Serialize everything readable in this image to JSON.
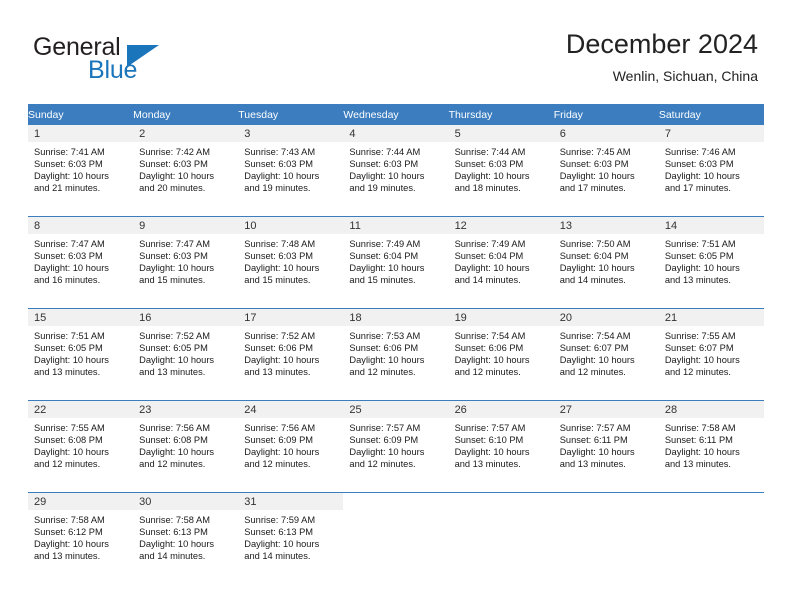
{
  "logo": {
    "line1": "General",
    "line2": "Blue",
    "triangle_icon": "blue-triangle-icon",
    "brand_color": "#1b75bb"
  },
  "header": {
    "title": "December 2024",
    "subtitle": "Wenlin, Sichuan, China"
  },
  "calendar": {
    "header_background": "#3b7dbf",
    "daynum_background": "#f1f1f1",
    "weekdays": [
      "Sunday",
      "Monday",
      "Tuesday",
      "Wednesday",
      "Thursday",
      "Friday",
      "Saturday"
    ],
    "weeks": [
      [
        {
          "day": "1",
          "sunrise": "Sunrise: 7:41 AM",
          "sunset": "Sunset: 6:03 PM",
          "daylight_line1": "Daylight: 10 hours",
          "daylight_line2": "and 21 minutes."
        },
        {
          "day": "2",
          "sunrise": "Sunrise: 7:42 AM",
          "sunset": "Sunset: 6:03 PM",
          "daylight_line1": "Daylight: 10 hours",
          "daylight_line2": "and 20 minutes."
        },
        {
          "day": "3",
          "sunrise": "Sunrise: 7:43 AM",
          "sunset": "Sunset: 6:03 PM",
          "daylight_line1": "Daylight: 10 hours",
          "daylight_line2": "and 19 minutes."
        },
        {
          "day": "4",
          "sunrise": "Sunrise: 7:44 AM",
          "sunset": "Sunset: 6:03 PM",
          "daylight_line1": "Daylight: 10 hours",
          "daylight_line2": "and 19 minutes."
        },
        {
          "day": "5",
          "sunrise": "Sunrise: 7:44 AM",
          "sunset": "Sunset: 6:03 PM",
          "daylight_line1": "Daylight: 10 hours",
          "daylight_line2": "and 18 minutes."
        },
        {
          "day": "6",
          "sunrise": "Sunrise: 7:45 AM",
          "sunset": "Sunset: 6:03 PM",
          "daylight_line1": "Daylight: 10 hours",
          "daylight_line2": "and 17 minutes."
        },
        {
          "day": "7",
          "sunrise": "Sunrise: 7:46 AM",
          "sunset": "Sunset: 6:03 PM",
          "daylight_line1": "Daylight: 10 hours",
          "daylight_line2": "and 17 minutes."
        }
      ],
      [
        {
          "day": "8",
          "sunrise": "Sunrise: 7:47 AM",
          "sunset": "Sunset: 6:03 PM",
          "daylight_line1": "Daylight: 10 hours",
          "daylight_line2": "and 16 minutes."
        },
        {
          "day": "9",
          "sunrise": "Sunrise: 7:47 AM",
          "sunset": "Sunset: 6:03 PM",
          "daylight_line1": "Daylight: 10 hours",
          "daylight_line2": "and 15 minutes."
        },
        {
          "day": "10",
          "sunrise": "Sunrise: 7:48 AM",
          "sunset": "Sunset: 6:03 PM",
          "daylight_line1": "Daylight: 10 hours",
          "daylight_line2": "and 15 minutes."
        },
        {
          "day": "11",
          "sunrise": "Sunrise: 7:49 AM",
          "sunset": "Sunset: 6:04 PM",
          "daylight_line1": "Daylight: 10 hours",
          "daylight_line2": "and 15 minutes."
        },
        {
          "day": "12",
          "sunrise": "Sunrise: 7:49 AM",
          "sunset": "Sunset: 6:04 PM",
          "daylight_line1": "Daylight: 10 hours",
          "daylight_line2": "and 14 minutes."
        },
        {
          "day": "13",
          "sunrise": "Sunrise: 7:50 AM",
          "sunset": "Sunset: 6:04 PM",
          "daylight_line1": "Daylight: 10 hours",
          "daylight_line2": "and 14 minutes."
        },
        {
          "day": "14",
          "sunrise": "Sunrise: 7:51 AM",
          "sunset": "Sunset: 6:05 PM",
          "daylight_line1": "Daylight: 10 hours",
          "daylight_line2": "and 13 minutes."
        }
      ],
      [
        {
          "day": "15",
          "sunrise": "Sunrise: 7:51 AM",
          "sunset": "Sunset: 6:05 PM",
          "daylight_line1": "Daylight: 10 hours",
          "daylight_line2": "and 13 minutes."
        },
        {
          "day": "16",
          "sunrise": "Sunrise: 7:52 AM",
          "sunset": "Sunset: 6:05 PM",
          "daylight_line1": "Daylight: 10 hours",
          "daylight_line2": "and 13 minutes."
        },
        {
          "day": "17",
          "sunrise": "Sunrise: 7:52 AM",
          "sunset": "Sunset: 6:06 PM",
          "daylight_line1": "Daylight: 10 hours",
          "daylight_line2": "and 13 minutes."
        },
        {
          "day": "18",
          "sunrise": "Sunrise: 7:53 AM",
          "sunset": "Sunset: 6:06 PM",
          "daylight_line1": "Daylight: 10 hours",
          "daylight_line2": "and 12 minutes."
        },
        {
          "day": "19",
          "sunrise": "Sunrise: 7:54 AM",
          "sunset": "Sunset: 6:06 PM",
          "daylight_line1": "Daylight: 10 hours",
          "daylight_line2": "and 12 minutes."
        },
        {
          "day": "20",
          "sunrise": "Sunrise: 7:54 AM",
          "sunset": "Sunset: 6:07 PM",
          "daylight_line1": "Daylight: 10 hours",
          "daylight_line2": "and 12 minutes."
        },
        {
          "day": "21",
          "sunrise": "Sunrise: 7:55 AM",
          "sunset": "Sunset: 6:07 PM",
          "daylight_line1": "Daylight: 10 hours",
          "daylight_line2": "and 12 minutes."
        }
      ],
      [
        {
          "day": "22",
          "sunrise": "Sunrise: 7:55 AM",
          "sunset": "Sunset: 6:08 PM",
          "daylight_line1": "Daylight: 10 hours",
          "daylight_line2": "and 12 minutes."
        },
        {
          "day": "23",
          "sunrise": "Sunrise: 7:56 AM",
          "sunset": "Sunset: 6:08 PM",
          "daylight_line1": "Daylight: 10 hours",
          "daylight_line2": "and 12 minutes."
        },
        {
          "day": "24",
          "sunrise": "Sunrise: 7:56 AM",
          "sunset": "Sunset: 6:09 PM",
          "daylight_line1": "Daylight: 10 hours",
          "daylight_line2": "and 12 minutes."
        },
        {
          "day": "25",
          "sunrise": "Sunrise: 7:57 AM",
          "sunset": "Sunset: 6:09 PM",
          "daylight_line1": "Daylight: 10 hours",
          "daylight_line2": "and 12 minutes."
        },
        {
          "day": "26",
          "sunrise": "Sunrise: 7:57 AM",
          "sunset": "Sunset: 6:10 PM",
          "daylight_line1": "Daylight: 10 hours",
          "daylight_line2": "and 13 minutes."
        },
        {
          "day": "27",
          "sunrise": "Sunrise: 7:57 AM",
          "sunset": "Sunset: 6:11 PM",
          "daylight_line1": "Daylight: 10 hours",
          "daylight_line2": "and 13 minutes."
        },
        {
          "day": "28",
          "sunrise": "Sunrise: 7:58 AM",
          "sunset": "Sunset: 6:11 PM",
          "daylight_line1": "Daylight: 10 hours",
          "daylight_line2": "and 13 minutes."
        }
      ],
      [
        {
          "day": "29",
          "sunrise": "Sunrise: 7:58 AM",
          "sunset": "Sunset: 6:12 PM",
          "daylight_line1": "Daylight: 10 hours",
          "daylight_line2": "and 13 minutes."
        },
        {
          "day": "30",
          "sunrise": "Sunrise: 7:58 AM",
          "sunset": "Sunset: 6:13 PM",
          "daylight_line1": "Daylight: 10 hours",
          "daylight_line2": "and 14 minutes."
        },
        {
          "day": "31",
          "sunrise": "Sunrise: 7:59 AM",
          "sunset": "Sunset: 6:13 PM",
          "daylight_line1": "Daylight: 10 hours",
          "daylight_line2": "and 14 minutes."
        },
        {
          "day": "",
          "sunrise": "",
          "sunset": "",
          "daylight_line1": "",
          "daylight_line2": ""
        },
        {
          "day": "",
          "sunrise": "",
          "sunset": "",
          "daylight_line1": "",
          "daylight_line2": ""
        },
        {
          "day": "",
          "sunrise": "",
          "sunset": "",
          "daylight_line1": "",
          "daylight_line2": ""
        },
        {
          "day": "",
          "sunrise": "",
          "sunset": "",
          "daylight_line1": "",
          "daylight_line2": ""
        }
      ]
    ]
  }
}
